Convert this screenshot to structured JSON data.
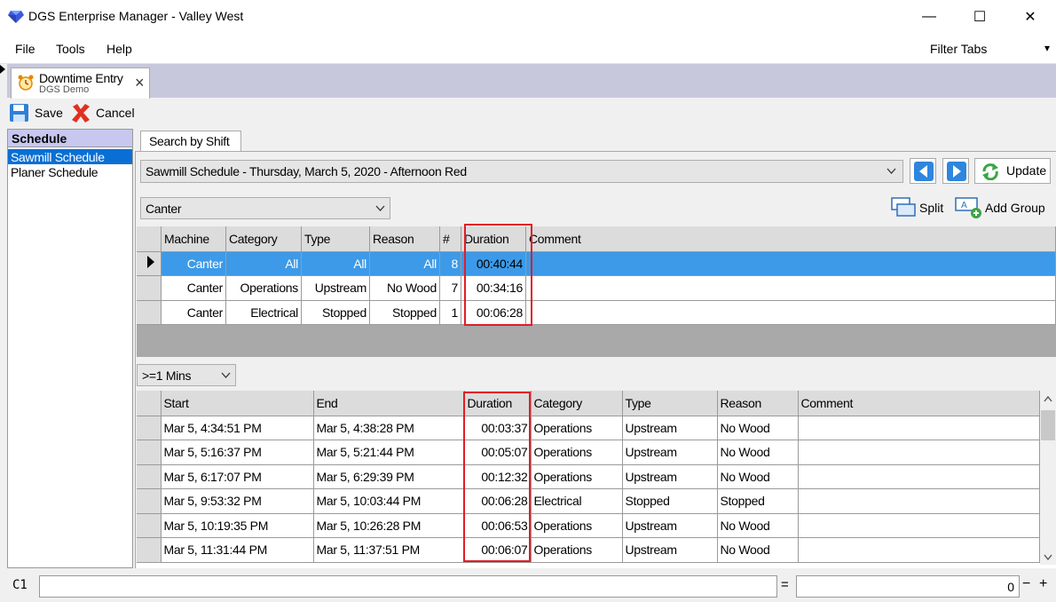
{
  "window": {
    "title": "DGS Enterprise Manager - Valley West",
    "minimize": "—",
    "maximize": "☐",
    "close": "✕"
  },
  "menu": {
    "file": "File",
    "tools": "Tools",
    "help": "Help",
    "filter_tabs": "Filter Tabs",
    "filter_caret": "▾"
  },
  "doc_tab": {
    "title": "Downtime Entry",
    "subtitle": "DGS Demo",
    "close": "×"
  },
  "toolbar": {
    "save": "Save",
    "cancel": "Cancel"
  },
  "schedule": {
    "header": "Schedule",
    "items": [
      "Sawmill Schedule",
      "Planer Schedule"
    ]
  },
  "search_tab": "Search by Shift",
  "shift_select": "Sawmill Schedule - Thursday, March 5, 2020 - Afternoon Red",
  "update_label": "Update",
  "machine_select": "Canter",
  "split_label": "Split",
  "add_group_label": "Add Group",
  "summary": {
    "headers": [
      "Machine",
      "Category",
      "Type",
      "Reason",
      "#",
      "Duration",
      "Comment"
    ],
    "rows": [
      [
        "Canter",
        "All",
        "All",
        "All",
        "8",
        "00:40:44",
        ""
      ],
      [
        "Canter",
        "Operations",
        "Upstream",
        "No Wood",
        "7",
        "00:34:16",
        ""
      ],
      [
        "Canter",
        "Electrical",
        "Stopped",
        "Stopped",
        "1",
        "00:06:28",
        ""
      ]
    ]
  },
  "min_filter": ">=1 Mins",
  "events": {
    "headers": [
      "Start",
      "End",
      "Duration",
      "Category",
      "Type",
      "Reason",
      "Comment"
    ],
    "rows": [
      [
        "Mar 5, 4:34:51 PM",
        "Mar 5, 4:38:28 PM",
        "00:03:37",
        "Operations",
        "Upstream",
        "No Wood",
        ""
      ],
      [
        "Mar 5, 5:16:37 PM",
        "Mar 5, 5:21:44 PM",
        "00:05:07",
        "Operations",
        "Upstream",
        "No Wood",
        ""
      ],
      [
        "Mar 5, 6:17:07 PM",
        "Mar 5, 6:29:39 PM",
        "00:12:32",
        "Operations",
        "Upstream",
        "No Wood",
        ""
      ],
      [
        "Mar 5, 9:53:32 PM",
        "Mar 5, 10:03:44 PM",
        "00:06:28",
        "Electrical",
        "Stopped",
        "Stopped",
        ""
      ],
      [
        "Mar 5, 10:19:35 PM",
        "Mar 5, 10:26:28 PM",
        "00:06:53",
        "Operations",
        "Upstream",
        "No Wood",
        ""
      ],
      [
        "Mar 5, 11:31:44 PM",
        "Mar 5, 11:37:51 PM",
        "00:06:07",
        "Operations",
        "Upstream",
        "No Wood",
        ""
      ]
    ]
  },
  "status": {
    "cell_ref": "C1",
    "equals": "=",
    "value": "0",
    "minus": "−",
    "plus": "+"
  },
  "colors": {
    "selection": "#3c9ae8",
    "highlight_box": "#e11d27",
    "tab_strip": "#c8c8dc",
    "schedule_header": "#c7c7f0"
  }
}
